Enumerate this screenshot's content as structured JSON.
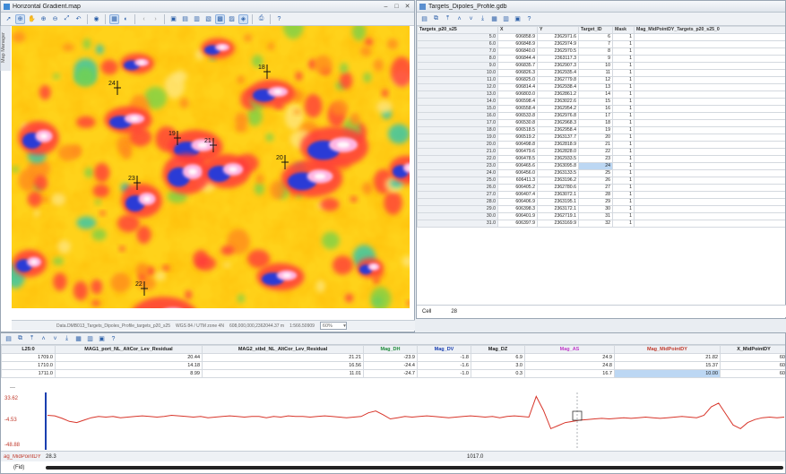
{
  "map_window": {
    "title": "Horizontal Gradient.map",
    "side_tab": "Map Manager",
    "status": {
      "path": "Data.DMB013_Targets_Dipoles_Profile_targets_p20_s25",
      "crs": "WGS 84 / UTM zone 4N",
      "coords": "608,000,000,2362044.37 m",
      "scale": "1:566.50909",
      "zoom": "60%"
    },
    "target_labels": [
      "18",
      "24",
      "23",
      "19",
      "21",
      "20",
      "22"
    ],
    "colors": {
      "low": "#2b3bd6",
      "mid": "#ffd21a",
      "high": "#ff3a3a",
      "peak": "#ffb6e3"
    }
  },
  "table_window": {
    "title": "Targets_Dipoles_Profile.gdb",
    "columns": [
      "Targets_p20_s25",
      "X",
      "Y",
      "Target_ID",
      "Mask",
      "Mag_MidPointDY_Targets_p20_s25_0"
    ],
    "rows": [
      [
        "5.0",
        "606858.9",
        "2362971.6",
        "6",
        "1"
      ],
      [
        "6.0",
        "606848.9",
        "2362974.9",
        "7",
        "1"
      ],
      [
        "7.0",
        "606840.0",
        "2362970.5",
        "8",
        "1"
      ],
      [
        "8.0",
        "606844.4",
        "2363117.3",
        "9",
        "1"
      ],
      [
        "9.0",
        "606835.7",
        "2362907.3",
        "10",
        "1"
      ],
      [
        "10.0",
        "606826.3",
        "2362935.4",
        "11",
        "1"
      ],
      [
        "11.0",
        "606825.0",
        "2362779.8",
        "12",
        "1"
      ],
      [
        "12.0",
        "606814.4",
        "2362938.4",
        "13",
        "1"
      ],
      [
        "13.0",
        "606803.0",
        "2362861.2",
        "14",
        "1"
      ],
      [
        "14.0",
        "606598.4",
        "2363022.6",
        "15",
        "1"
      ],
      [
        "15.0",
        "606558.4",
        "2362954.2",
        "16",
        "1"
      ],
      [
        "16.0",
        "606533.8",
        "2362976.8",
        "17",
        "1"
      ],
      [
        "17.0",
        "606530.8",
        "2362968.3",
        "18",
        "1"
      ],
      [
        "18.0",
        "606518.5",
        "2362958.4",
        "19",
        "1"
      ],
      [
        "19.0",
        "606519.2",
        "2363137.7",
        "20",
        "1"
      ],
      [
        "20.0",
        "606498.8",
        "2362818.9",
        "21",
        "1"
      ],
      [
        "21.0",
        "606479.6",
        "2362828.0",
        "22",
        "1"
      ],
      [
        "22.0",
        "606478.5",
        "2362933.5",
        "23",
        "1"
      ],
      [
        "23.0",
        "606465.6",
        "2363095.8",
        "24",
        "1"
      ],
      [
        "24.0",
        "606456.0",
        "2363133.5",
        "25",
        "1"
      ],
      [
        "25.0",
        "606411.3",
        "2363196.2",
        "26",
        "1"
      ],
      [
        "26.0",
        "606405.2",
        "2362780.6",
        "27",
        "1"
      ],
      [
        "27.0",
        "606407.4",
        "2363072.1",
        "28",
        "1"
      ],
      [
        "28.0",
        "606406.9",
        "2363195.1",
        "29",
        "1"
      ],
      [
        "29.0",
        "606398.3",
        "2363172.1",
        "30",
        "1"
      ],
      [
        "30.0",
        "606401.9",
        "2362719.1",
        "31",
        "1"
      ],
      [
        "31.0",
        "606397.9",
        "2363169.9",
        "32",
        "1"
      ]
    ],
    "selected_row": 18,
    "cell_label": "Cell",
    "cell_value": "28"
  },
  "bottom_table": {
    "line": "L25:0",
    "columns": [
      "MAG1_port_NL_AltCor_Lev_Residual",
      "MAG2_stbd_NL_AltCor_Lev_Residual",
      "Mag_DH",
      "Mag_DV",
      "Mag_DZ",
      "Mag_AS",
      "Mag_MidPointDY",
      "X_MidPointDY"
    ],
    "column_colors": [
      "#222",
      "#222",
      "#1e8a3a",
      "#1a3fb0",
      "#222",
      "#c03bc9",
      "#c0392b",
      "#222"
    ],
    "rows": [
      [
        "1709.0",
        "20.44",
        "21.21",
        "-23.9",
        "-1.8",
        "6.9",
        "24.9",
        "21.82",
        "60"
      ],
      [
        "1710.0",
        "14.18",
        "16.56",
        "-24.4",
        "-1.6",
        "3.0",
        "24.8",
        "15.37",
        "60"
      ],
      [
        "1711.0",
        "8.99",
        "11.01",
        "-24.7",
        "-1.0",
        "0.3",
        "16.7",
        "10.00",
        "60"
      ]
    ]
  },
  "profile": {
    "ymax_label": "33.62",
    "ymid_label": "-4.53",
    "ymin_label": "-48.88",
    "channel": "ag_MidPointDY",
    "channel_value": "28.3",
    "fid_label": "(Fid)",
    "fid_value": "1017.0",
    "color": "#d8352a",
    "values": [
      2,
      1,
      -3,
      -8,
      -10,
      -6,
      -2,
      0,
      -1,
      0,
      -2,
      -1,
      0,
      1,
      0,
      -1,
      0,
      2,
      1,
      0,
      -1,
      0,
      -2,
      -1,
      0,
      1,
      0,
      -1,
      0,
      0,
      -2,
      0,
      -1,
      1,
      0,
      0,
      -1,
      0,
      1,
      0,
      -1,
      -2,
      -1,
      0,
      6,
      9,
      3,
      -4,
      -2,
      0,
      -1,
      0,
      1,
      0,
      -1,
      -2,
      -1,
      0,
      1,
      0,
      -1,
      0,
      -2,
      0,
      1,
      0,
      -1,
      33,
      10,
      -20,
      -15,
      -10,
      -8,
      -6,
      -5,
      -4,
      -3,
      -4,
      -3,
      -2,
      -3,
      -2,
      -1,
      -2,
      -3,
      -2,
      -1,
      0,
      -1,
      -2,
      2,
      16,
      22,
      4,
      -14,
      -20,
      -10,
      -5,
      -2,
      -1,
      -2,
      -1
    ]
  }
}
